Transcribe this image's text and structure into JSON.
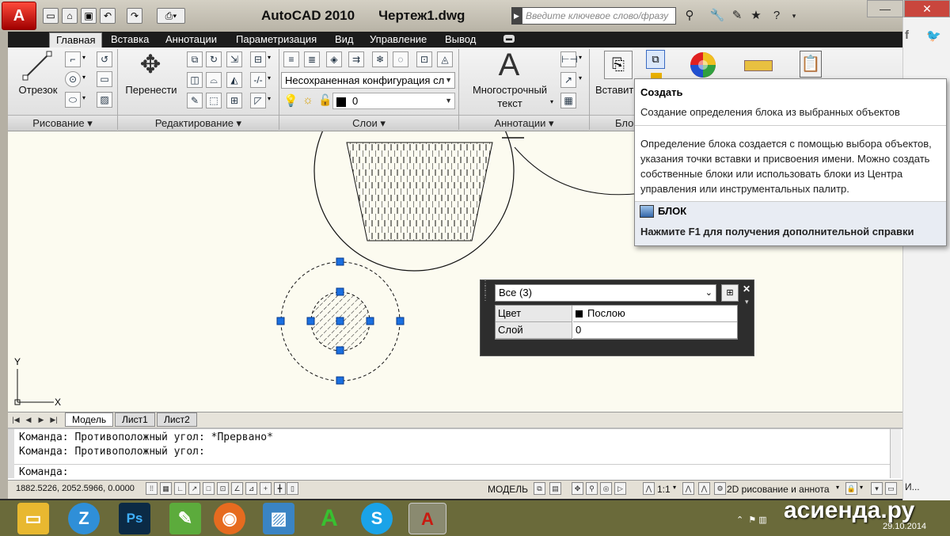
{
  "window": {
    "app_title": "AutoCAD 2010",
    "file_title": "Чертеж1.dwg",
    "search_placeholder": "Введите ключевое слово/фразу"
  },
  "ribbon": {
    "tabs": [
      "Главная",
      "Вставка",
      "Аннотации",
      "Параметризация",
      "Вид",
      "Управление",
      "Вывод"
    ],
    "active_tab": "Главная",
    "draw": {
      "line_label": "Отрезок",
      "panel_title": "Рисование ▾"
    },
    "modify": {
      "move_label": "Перенести",
      "panel_title": "Редактирование ▾"
    },
    "layers": {
      "layer_state": "Несохраненная конфигурация сл",
      "current_layer": "0",
      "panel_title": "Слои ▾"
    },
    "annotation": {
      "mtext_label_1": "Многострочный",
      "mtext_label_2": "текст",
      "panel_title": "Аннотации ▾"
    },
    "block": {
      "insert_label": "Вставит",
      "panel_title": "Бло"
    }
  },
  "tooltip": {
    "title": "Создать",
    "subtitle": "Создание определения блока из выбранных объектов",
    "body": "Определение блока создается с помощью выбора объектов, указания точки вставки и присвоения имени. Можно создать собственные блоки или использовать блоки из Центра управления или инструментальных палитр.",
    "command": "БЛОК",
    "help": "Нажмите F1 для получения дополнительной справки"
  },
  "quick_properties": {
    "selection": "Все (3)",
    "rows": [
      {
        "label": "Цвет",
        "value": "Послою"
      },
      {
        "label": "Слой",
        "value": "0"
      }
    ]
  },
  "ucs": {
    "x_label": "X",
    "y_label": "Y"
  },
  "layout_tabs": [
    "Модель",
    "Лист1",
    "Лист2"
  ],
  "command_history": [
    "Команда: Противоположный угол: *Прервано*",
    "Команда: Противоположный угол:"
  ],
  "command_prompt": "Команда:",
  "status": {
    "coordinates": "1882.5226, 2052.5966, 0.0000",
    "space": "МОДЕЛЬ",
    "scale": "1:1",
    "workspace": "2D рисование и аннота"
  },
  "right_strip": {
    "text": "И..."
  },
  "taskbar": {
    "watermark": "асиенда.ру",
    "date": "29.10.2014",
    "apps": [
      "file-explorer",
      "zoho",
      "photoshop",
      "notepad",
      "firefox",
      "photo-viewer",
      "autocad-green",
      "skype",
      "autocad"
    ]
  },
  "colors": {
    "accent_red": "#c81a10",
    "grip_blue": "#1a6fe0",
    "drawing_bg": "#fcfbf0",
    "ribbon_bar": "#1c1c1c"
  }
}
